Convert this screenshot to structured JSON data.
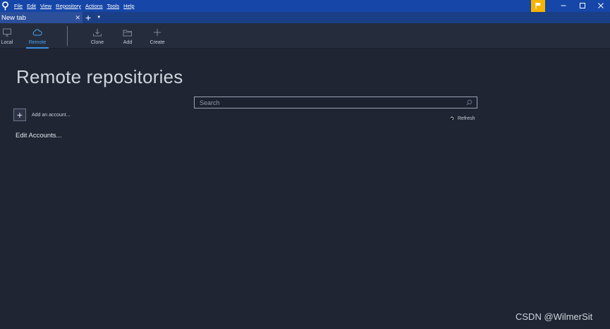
{
  "menu": {
    "items": [
      "File",
      "Edit",
      "View",
      "Repository",
      "Actions",
      "Tools",
      "Help"
    ]
  },
  "window": {
    "minimize_icon": "minimize-icon",
    "maximize_icon": "maximize-icon",
    "close_icon": "close-icon",
    "flag_color": "#f4b400",
    "titlebar_color": "#1546a8"
  },
  "tabs": {
    "items": [
      {
        "label": "New tab"
      }
    ]
  },
  "toolbar": {
    "local": "Local",
    "remote": "Remote",
    "clone": "Clone",
    "add": "Add",
    "create": "Create",
    "active_color": "#4aa3f0"
  },
  "main": {
    "title": "Remote repositories",
    "search_placeholder": "Search",
    "refresh": "Refresh",
    "add_account": "Add an account...",
    "edit_accounts": "Edit Accounts..."
  },
  "watermark": "CSDN @WilmerSit"
}
